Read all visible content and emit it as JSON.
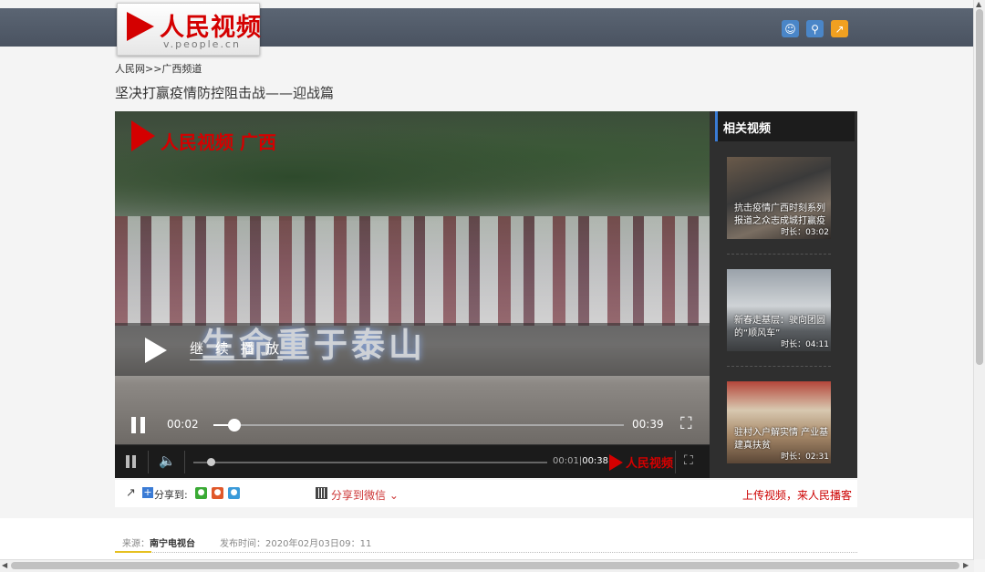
{
  "header": {
    "logo_text": "人民视频",
    "logo_sub": "v.people.cn",
    "icons": [
      "user-icon",
      "search-icon",
      "share-icon"
    ]
  },
  "breadcrumb": "人民网>>广西频道",
  "title": "坚决打赢疫情防控阻击战——迎战篇",
  "player": {
    "watermark": "人民视频 广西",
    "slogan": "生命重于泰山",
    "continue_label": "继 续 播 放",
    "current_time": "00:02",
    "duration": "00:39",
    "progress": 0.05,
    "mini_current": "00:01",
    "mini_duration": "00:38",
    "mini_progress": 0.05,
    "brand": "人民视频"
  },
  "related": {
    "heading": "相关视频",
    "items": [
      {
        "caption": "抗击疫情广西时刻系列报道之众志成城打赢疫",
        "duration": "时长：03:02"
      },
      {
        "caption": "新春走基层：驶向团圆的“顺风车”",
        "duration": "时长：04:11"
      },
      {
        "caption": "驻村入户解实情 产业基建真扶贫",
        "duration": "时长：02:31"
      }
    ]
  },
  "share": {
    "label": "分享到:",
    "wechat_label": "分享到微信",
    "upload_label": "上传视频，来人民播客"
  },
  "meta": {
    "source_label": "来源：",
    "source": "南宁电视台",
    "publish": "发布时间：2020年02月03日09：11"
  },
  "colors": {
    "brand_red": "#d40000",
    "accent_blue": "#3a7bd5"
  }
}
